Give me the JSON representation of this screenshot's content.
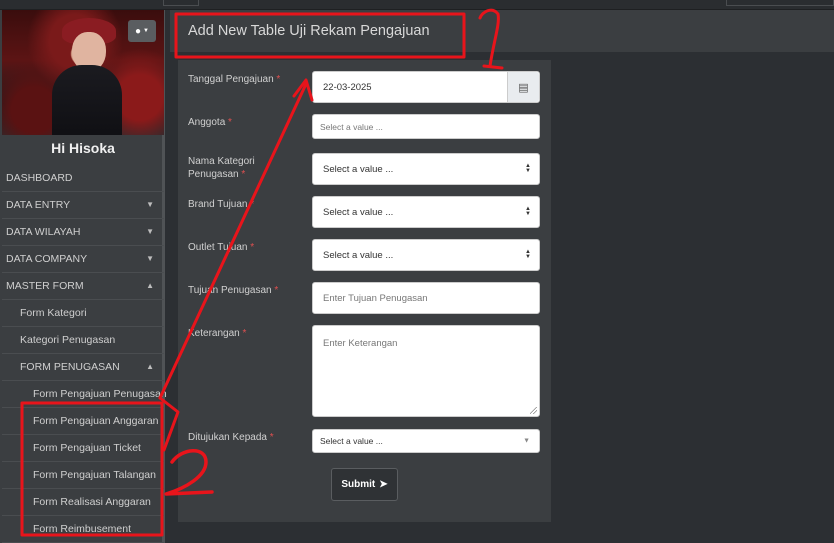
{
  "sidebar": {
    "greeting": "Hi Hisoka",
    "user_menu_icon": "user-icon",
    "items": [
      {
        "label": "DASHBOARD",
        "caret": ""
      },
      {
        "label": "DATA ENTRY",
        "caret": "▼"
      },
      {
        "label": "DATA WILAYAH",
        "caret": "▼"
      },
      {
        "label": "DATA COMPANY",
        "caret": "▼"
      },
      {
        "label": "MASTER FORM",
        "caret": "▲"
      },
      {
        "label": "Form Kategori",
        "caret": ""
      },
      {
        "label": "Kategori Penugasan",
        "caret": ""
      },
      {
        "label": "FORM PENUGASAN",
        "caret": "▲"
      },
      {
        "label": "Form Pengajuan Penugasan",
        "caret": ""
      },
      {
        "label": "Form Pengajuan Anggaran",
        "caret": ""
      },
      {
        "label": "Form Pengajuan Ticket",
        "caret": ""
      },
      {
        "label": "Form Pengajuan Talangan",
        "caret": ""
      },
      {
        "label": "Form Realisasi Anggaran",
        "caret": ""
      },
      {
        "label": "Form Reimbusement",
        "caret": ""
      }
    ]
  },
  "header": {
    "title": "Add New Table Uji Rekam Pengajuan"
  },
  "form": {
    "required_mark": "*",
    "tanggal": {
      "label": "Tanggal Pengajuan",
      "value": "22-03-2025"
    },
    "anggota": {
      "label": "Anggota",
      "value": "Select a value ..."
    },
    "kategori": {
      "label": "Nama Kategori Penugasan",
      "value": "Select a value ..."
    },
    "brand": {
      "label": "Brand Tujuan",
      "value": "Select a value ..."
    },
    "outlet": {
      "label": "Outlet Tujuan",
      "value": "Select a value ..."
    },
    "tujuan": {
      "label": "Tujuan Penugasan",
      "placeholder": "Enter Tujuan Penugasan"
    },
    "keterangan": {
      "label": "Keterangan",
      "placeholder": "Enter Keterangan"
    },
    "ditujukan": {
      "label": "Ditujukan Kepada",
      "value": "Select a value ..."
    },
    "submit_label": "Submit"
  },
  "annotations": {
    "marker_1": "1",
    "marker_2": "2",
    "color": "#e8141b"
  }
}
